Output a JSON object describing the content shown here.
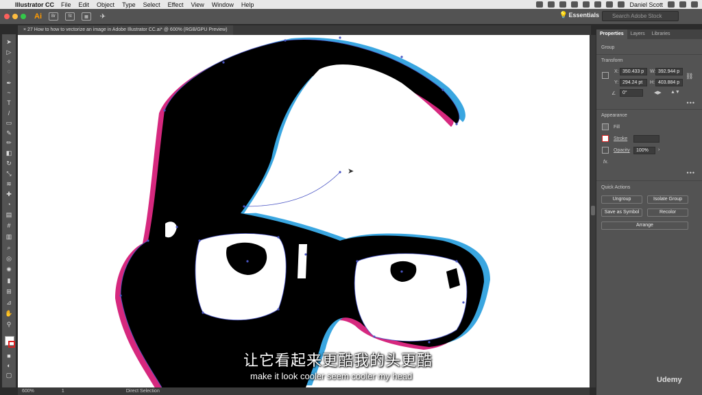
{
  "menubar": {
    "app_name": "Illustrator CC",
    "items": [
      "File",
      "Edit",
      "Object",
      "Type",
      "Select",
      "Effect",
      "View",
      "Window",
      "Help"
    ],
    "user": "Daniel Scott"
  },
  "appbar": {
    "logo": "Ai",
    "workspace": "Essentials",
    "search_placeholder": "Search Adobe Stock",
    "br_label": "Br",
    "st_label": "St"
  },
  "document": {
    "tab_title": "27 How to how to vectorize an image in Adobe Illustrator CC.ai* @ 600% (RGB/GPU Preview)"
  },
  "status": {
    "zoom": "600%",
    "artboard": "1",
    "tool": "Direct Selection"
  },
  "subtitles": {
    "zh": "让它看起来更酷我的头更酷",
    "en": "make it look cooler seem cooler my head"
  },
  "panel": {
    "tabs": [
      "Properties",
      "Layers",
      "Libraries"
    ],
    "active_tab": "Properties",
    "object_type": "Group",
    "transform": {
      "title": "Transform",
      "x_label": "X:",
      "x": "350.433 p",
      "y_label": "Y:",
      "y": "294.24 pt",
      "w_label": "W:",
      "w": "392.944 p",
      "h_label": "H:",
      "h": "403.884 p",
      "angle": "0°"
    },
    "appearance": {
      "title": "Appearance",
      "fill_label": "Fill",
      "stroke_label": "Stroke",
      "opacity_label": "Opacity",
      "opacity": "100%",
      "fx_label": "fx."
    },
    "quick_actions": {
      "title": "Quick Actions",
      "ungroup": "Ungroup",
      "isolate": "Isolate Group",
      "save_symbol": "Save as Symbol",
      "recolor": "Recolor",
      "arrange": "Arrange"
    }
  },
  "watermark": "Udemy",
  "colors": {
    "magenta": "#d6287e",
    "cyan": "#3aa6e0",
    "path": "#4a55c4",
    "ui_dark": "#535353",
    "ai_orange": "#ff9a00"
  }
}
